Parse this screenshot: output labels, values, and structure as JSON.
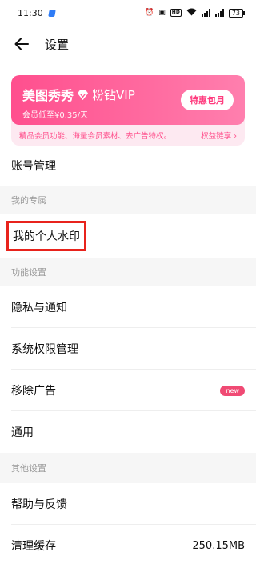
{
  "status_bar": {
    "time": "11:30",
    "battery": "73",
    "hd_label": "HD"
  },
  "nav": {
    "title": "设置"
  },
  "vip": {
    "title_part1": "美图秀秀",
    "title_part2": "粉钻VIP",
    "subtitle": "会员低至¥0.35/天",
    "button": "特惠包月",
    "benefits": "精品会员功能、海量会员素材、去广告特权。",
    "benefits_link": "权益链享 ›",
    "colors": {
      "accent": "#ff4f8e",
      "soft": "#fde9f1"
    }
  },
  "account": {
    "label": "账号管理"
  },
  "section_exclusive": {
    "header": "我的专属"
  },
  "watermark": {
    "label": "我的个人水印"
  },
  "section_function": {
    "header": "功能设置"
  },
  "function_items": {
    "privacy": "隐私与通知",
    "permissions": "系统权限管理",
    "remove_ads": "移除广告",
    "remove_ads_badge": "new",
    "general": "通用"
  },
  "section_other": {
    "header": "其他设置"
  },
  "other_items": {
    "help": "帮助与反馈",
    "cache": "清理缓存",
    "cache_size": "250.15MB"
  }
}
